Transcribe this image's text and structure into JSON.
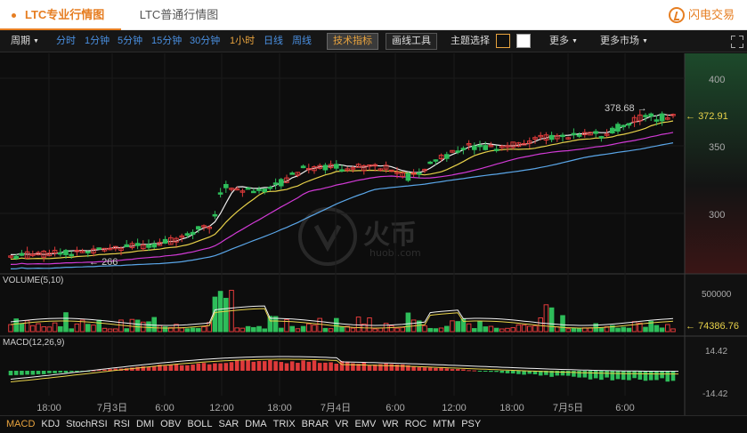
{
  "tabs": {
    "pro": "LTC专业行情图",
    "normal": "LTC普通行情图"
  },
  "logo": {
    "text": "闪电交易"
  },
  "toolbar": {
    "period": "周期",
    "intervals": [
      {
        "label": "分时",
        "active": false
      },
      {
        "label": "1分钟",
        "active": false
      },
      {
        "label": "5分钟",
        "active": false
      },
      {
        "label": "15分钟",
        "active": false
      },
      {
        "label": "30分钟",
        "active": false
      },
      {
        "label": "1小时",
        "active": true
      },
      {
        "label": "日线",
        "active": false
      },
      {
        "label": "周线",
        "active": false
      }
    ],
    "indicators_btn": "技术指标",
    "drawing_btn": "画线工具",
    "theme_label": "主题选择",
    "more": "更多",
    "more_markets": "更多市场"
  },
  "watermark": {
    "cn": "火币",
    "en": "huobi.com"
  },
  "main_panel": {
    "price_axis": [
      "400",
      "350",
      "300"
    ],
    "last_price": "372.91",
    "high_marker": "378.68",
    "low_marker": "266"
  },
  "volume_panel": {
    "title": "VOLUME(5,10)",
    "axis_label": "500000",
    "last_value": "74386.76"
  },
  "macd_panel": {
    "title": "MACD(12,26,9)",
    "axis_top": "14.42",
    "axis_bottom": "-14.42"
  },
  "time_axis": [
    "18:00",
    "7月3日",
    "6:00",
    "12:00",
    "18:00",
    "7月4日",
    "6:00",
    "12:00",
    "18:00",
    "7月5日",
    "6:00"
  ],
  "indicator_tabs": [
    {
      "label": "MACD",
      "active": true
    },
    {
      "label": "KDJ",
      "active": false
    },
    {
      "label": "StochRSI",
      "active": false
    },
    {
      "label": "RSI",
      "active": false
    },
    {
      "label": "DMI",
      "active": false
    },
    {
      "label": "OBV",
      "active": false
    },
    {
      "label": "BOLL",
      "active": false
    },
    {
      "label": "SAR",
      "active": false
    },
    {
      "label": "DMA",
      "active": false
    },
    {
      "label": "TRIX",
      "active": false
    },
    {
      "label": "BRAR",
      "active": false
    },
    {
      "label": "VR",
      "active": false
    },
    {
      "label": "EMV",
      "active": false
    },
    {
      "label": "WR",
      "active": false
    },
    {
      "label": "ROC",
      "active": false
    },
    {
      "label": "MTM",
      "active": false
    },
    {
      "label": "PSY",
      "active": false
    }
  ],
  "colors": {
    "up": "#2ebd5a",
    "down": "#e03a3a",
    "accent": "#e8a33e",
    "link": "#4a90e2"
  }
}
